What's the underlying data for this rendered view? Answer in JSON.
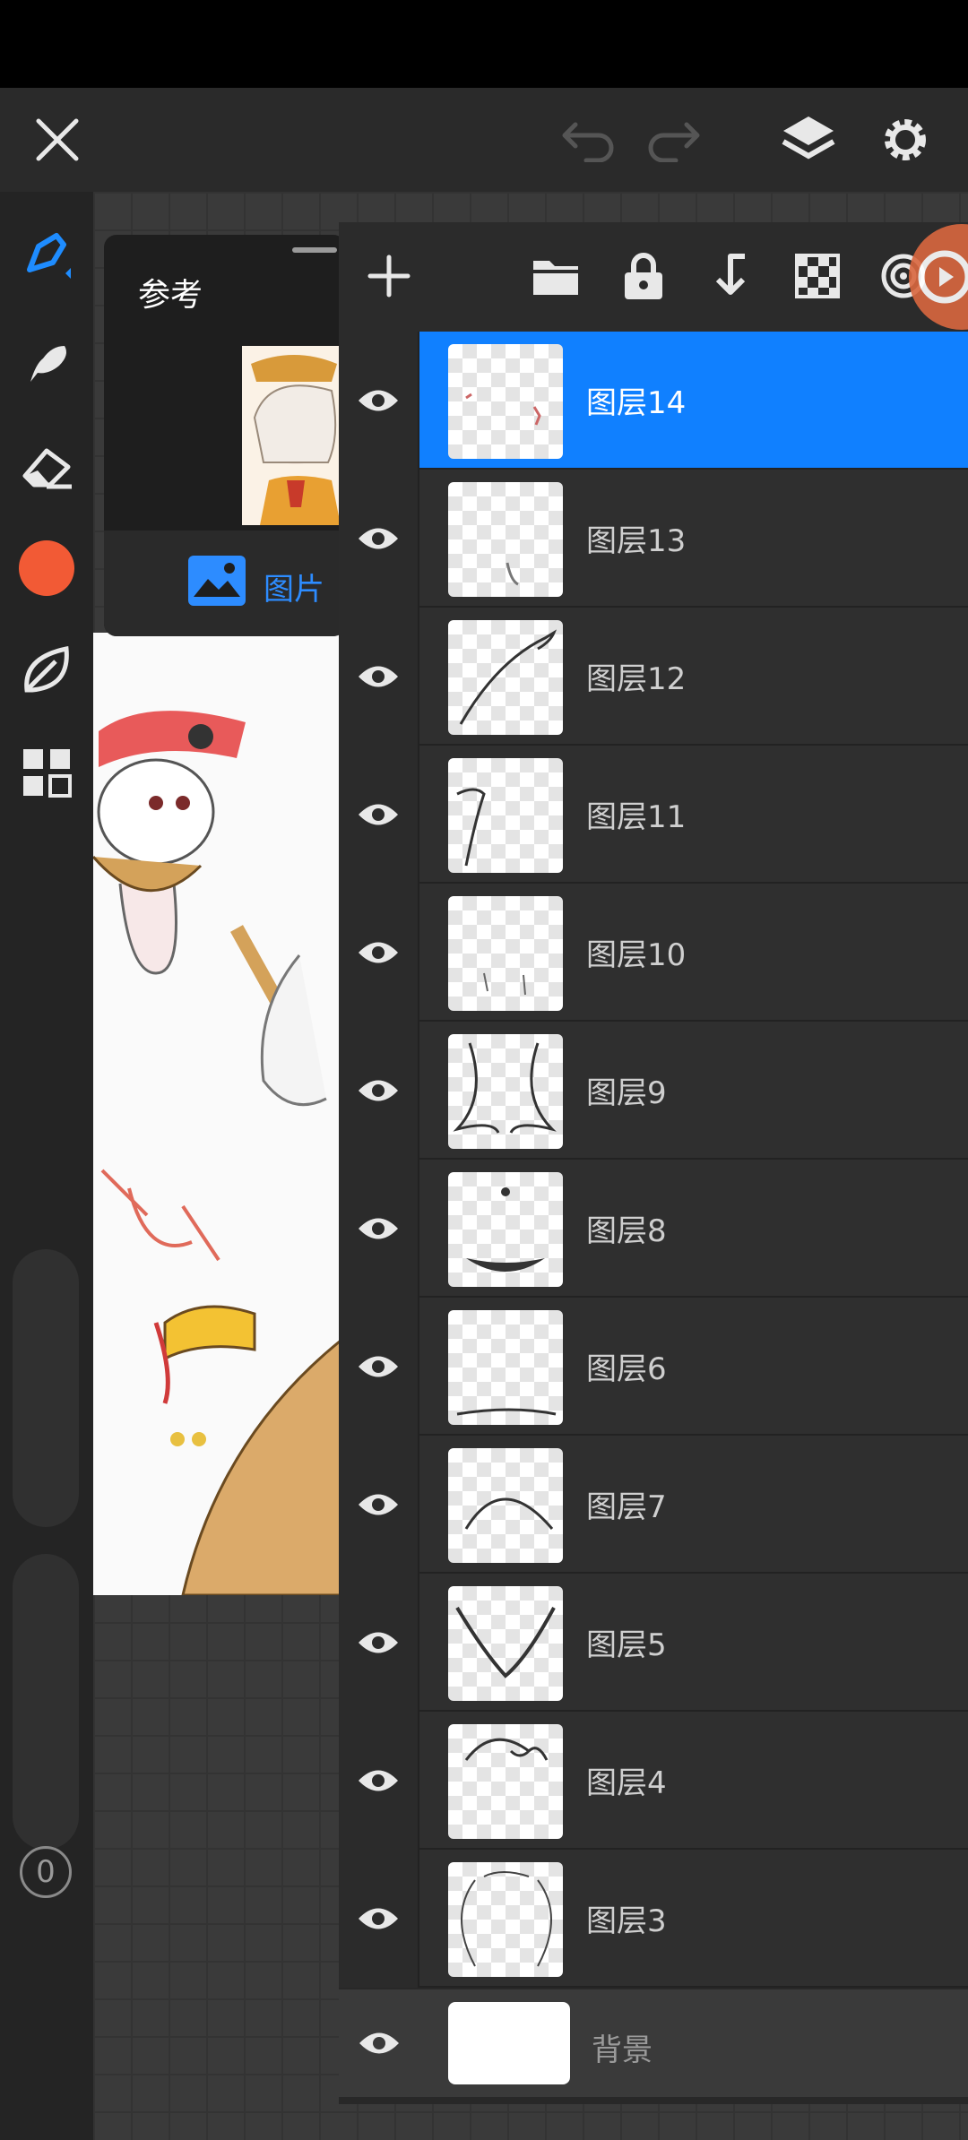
{
  "topbar": {
    "icons": [
      "close-icon",
      "undo-icon",
      "redo-icon",
      "layers-icon",
      "settings-icon"
    ]
  },
  "left_toolbar": {
    "tools": [
      "brush-icon",
      "smudge-icon",
      "eraser-icon",
      "color-swatch",
      "leaf-icon",
      "grid-icon"
    ],
    "color": "#f25a35",
    "size_knob": "S",
    "opacity_knob": "0"
  },
  "reference": {
    "title": "参考",
    "picture_label": "图片"
  },
  "layers_toolbar": {
    "icons": [
      "add-icon",
      "folder-icon",
      "lock-icon",
      "merge-down-icon",
      "checker-icon",
      "target-icon"
    ]
  },
  "layers": [
    {
      "name": "图层14",
      "selected": true
    },
    {
      "name": "图层13",
      "selected": false
    },
    {
      "name": "图层12",
      "selected": false
    },
    {
      "name": "图层11",
      "selected": false
    },
    {
      "name": "图层10",
      "selected": false
    },
    {
      "name": "图层9",
      "selected": false
    },
    {
      "name": "图层8",
      "selected": false
    },
    {
      "name": "图层6",
      "selected": false
    },
    {
      "name": "图层7",
      "selected": false
    },
    {
      "name": "图层5",
      "selected": false
    },
    {
      "name": "图层4",
      "selected": false
    },
    {
      "name": "图层3",
      "selected": false
    }
  ],
  "background_layer": {
    "name": "背景"
  },
  "colors": {
    "accent": "#1080ff",
    "picture_label": "#2d8cff"
  }
}
